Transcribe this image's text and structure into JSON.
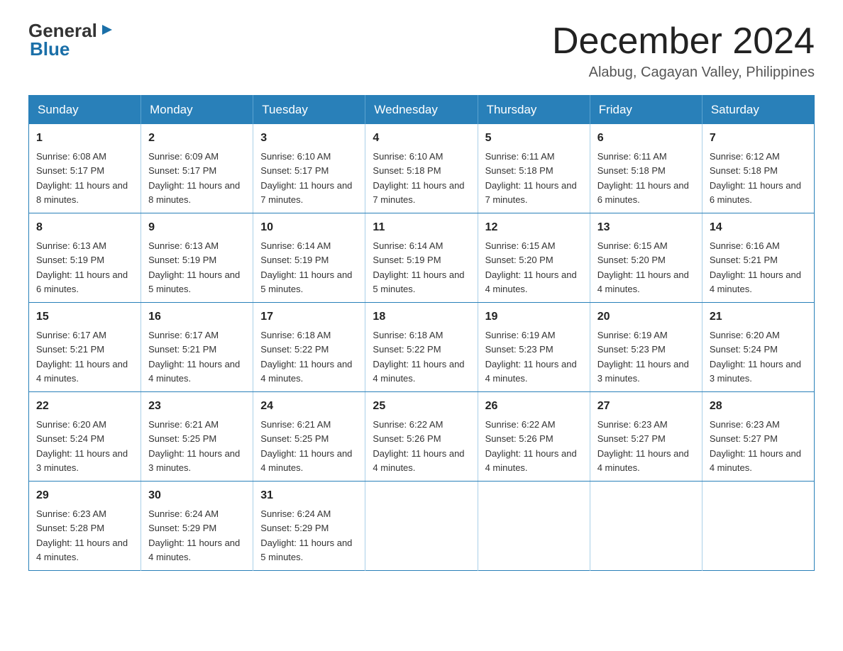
{
  "header": {
    "logo_general": "General",
    "logo_blue": "Blue",
    "month_title": "December 2024",
    "subtitle": "Alabug, Cagayan Valley, Philippines"
  },
  "calendar": {
    "days_of_week": [
      "Sunday",
      "Monday",
      "Tuesday",
      "Wednesday",
      "Thursday",
      "Friday",
      "Saturday"
    ],
    "weeks": [
      [
        {
          "day": "1",
          "sunrise": "6:08 AM",
          "sunset": "5:17 PM",
          "daylight": "11 hours and 8 minutes."
        },
        {
          "day": "2",
          "sunrise": "6:09 AM",
          "sunset": "5:17 PM",
          "daylight": "11 hours and 8 minutes."
        },
        {
          "day": "3",
          "sunrise": "6:10 AM",
          "sunset": "5:17 PM",
          "daylight": "11 hours and 7 minutes."
        },
        {
          "day": "4",
          "sunrise": "6:10 AM",
          "sunset": "5:18 PM",
          "daylight": "11 hours and 7 minutes."
        },
        {
          "day": "5",
          "sunrise": "6:11 AM",
          "sunset": "5:18 PM",
          "daylight": "11 hours and 7 minutes."
        },
        {
          "day": "6",
          "sunrise": "6:11 AM",
          "sunset": "5:18 PM",
          "daylight": "11 hours and 6 minutes."
        },
        {
          "day": "7",
          "sunrise": "6:12 AM",
          "sunset": "5:18 PM",
          "daylight": "11 hours and 6 minutes."
        }
      ],
      [
        {
          "day": "8",
          "sunrise": "6:13 AM",
          "sunset": "5:19 PM",
          "daylight": "11 hours and 6 minutes."
        },
        {
          "day": "9",
          "sunrise": "6:13 AM",
          "sunset": "5:19 PM",
          "daylight": "11 hours and 5 minutes."
        },
        {
          "day": "10",
          "sunrise": "6:14 AM",
          "sunset": "5:19 PM",
          "daylight": "11 hours and 5 minutes."
        },
        {
          "day": "11",
          "sunrise": "6:14 AM",
          "sunset": "5:19 PM",
          "daylight": "11 hours and 5 minutes."
        },
        {
          "day": "12",
          "sunrise": "6:15 AM",
          "sunset": "5:20 PM",
          "daylight": "11 hours and 4 minutes."
        },
        {
          "day": "13",
          "sunrise": "6:15 AM",
          "sunset": "5:20 PM",
          "daylight": "11 hours and 4 minutes."
        },
        {
          "day": "14",
          "sunrise": "6:16 AM",
          "sunset": "5:21 PM",
          "daylight": "11 hours and 4 minutes."
        }
      ],
      [
        {
          "day": "15",
          "sunrise": "6:17 AM",
          "sunset": "5:21 PM",
          "daylight": "11 hours and 4 minutes."
        },
        {
          "day": "16",
          "sunrise": "6:17 AM",
          "sunset": "5:21 PM",
          "daylight": "11 hours and 4 minutes."
        },
        {
          "day": "17",
          "sunrise": "6:18 AM",
          "sunset": "5:22 PM",
          "daylight": "11 hours and 4 minutes."
        },
        {
          "day": "18",
          "sunrise": "6:18 AM",
          "sunset": "5:22 PM",
          "daylight": "11 hours and 4 minutes."
        },
        {
          "day": "19",
          "sunrise": "6:19 AM",
          "sunset": "5:23 PM",
          "daylight": "11 hours and 4 minutes."
        },
        {
          "day": "20",
          "sunrise": "6:19 AM",
          "sunset": "5:23 PM",
          "daylight": "11 hours and 3 minutes."
        },
        {
          "day": "21",
          "sunrise": "6:20 AM",
          "sunset": "5:24 PM",
          "daylight": "11 hours and 3 minutes."
        }
      ],
      [
        {
          "day": "22",
          "sunrise": "6:20 AM",
          "sunset": "5:24 PM",
          "daylight": "11 hours and 3 minutes."
        },
        {
          "day": "23",
          "sunrise": "6:21 AM",
          "sunset": "5:25 PM",
          "daylight": "11 hours and 3 minutes."
        },
        {
          "day": "24",
          "sunrise": "6:21 AM",
          "sunset": "5:25 PM",
          "daylight": "11 hours and 4 minutes."
        },
        {
          "day": "25",
          "sunrise": "6:22 AM",
          "sunset": "5:26 PM",
          "daylight": "11 hours and 4 minutes."
        },
        {
          "day": "26",
          "sunrise": "6:22 AM",
          "sunset": "5:26 PM",
          "daylight": "11 hours and 4 minutes."
        },
        {
          "day": "27",
          "sunrise": "6:23 AM",
          "sunset": "5:27 PM",
          "daylight": "11 hours and 4 minutes."
        },
        {
          "day": "28",
          "sunrise": "6:23 AM",
          "sunset": "5:27 PM",
          "daylight": "11 hours and 4 minutes."
        }
      ],
      [
        {
          "day": "29",
          "sunrise": "6:23 AM",
          "sunset": "5:28 PM",
          "daylight": "11 hours and 4 minutes."
        },
        {
          "day": "30",
          "sunrise": "6:24 AM",
          "sunset": "5:29 PM",
          "daylight": "11 hours and 4 minutes."
        },
        {
          "day": "31",
          "sunrise": "6:24 AM",
          "sunset": "5:29 PM",
          "daylight": "11 hours and 5 minutes."
        },
        null,
        null,
        null,
        null
      ]
    ]
  }
}
